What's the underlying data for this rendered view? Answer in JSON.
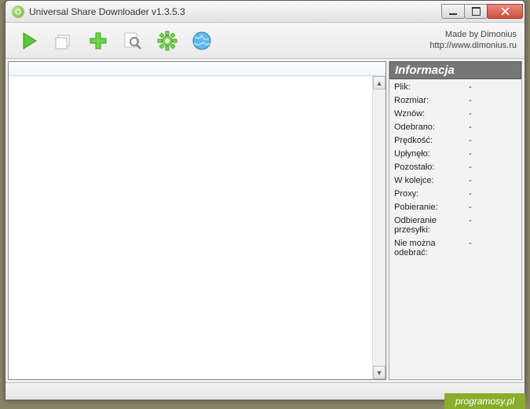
{
  "window": {
    "title": "Universal Share Downloader v1.3.5.3"
  },
  "credits": {
    "line1": "Made by Dimonius",
    "line2": "http://www.dimonius.ru"
  },
  "info": {
    "header": "Informacja",
    "rows": [
      {
        "label": "Plik:",
        "value": "-"
      },
      {
        "label": "Rozmiar:",
        "value": "-"
      },
      {
        "label": "Wznów:",
        "value": "-"
      },
      {
        "label": "Odebrano:",
        "value": "-"
      },
      {
        "label": "Prędkość:",
        "value": "-"
      },
      {
        "label": "Upłynęło:",
        "value": "-"
      },
      {
        "label": "Pozostało:",
        "value": "-"
      },
      {
        "label": "W kolejce:",
        "value": "-"
      },
      {
        "label": "Proxy:",
        "value": "-"
      },
      {
        "label": "Pobieranie:",
        "value": "-"
      },
      {
        "label": "Odbieranie przesyłki:",
        "value": "-"
      },
      {
        "label": "Nie można odebrać:",
        "value": "-"
      }
    ]
  },
  "watermark": "programosy.pl"
}
